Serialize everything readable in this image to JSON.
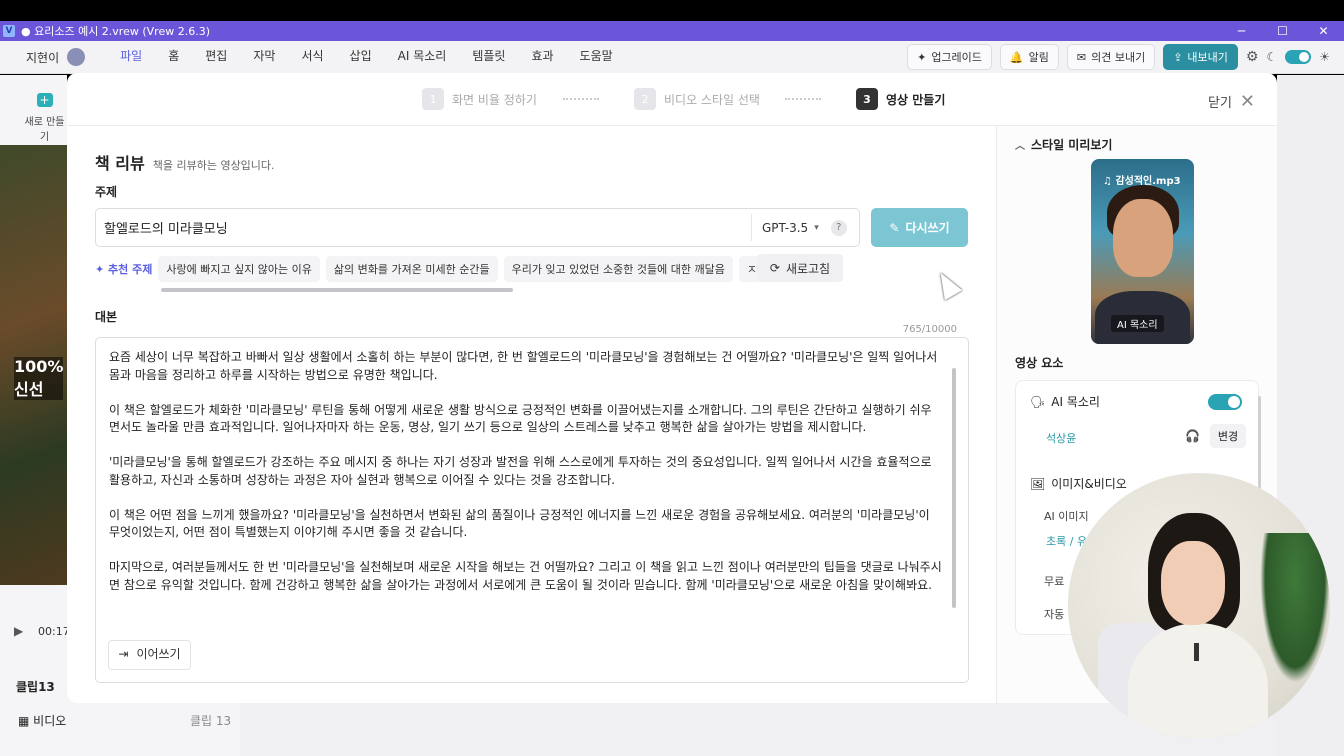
{
  "window": {
    "title": "● 요리소즈 예시 2.vrew (Vrew 2.6.3)",
    "controls": [
      "─",
      "☐",
      "✕"
    ]
  },
  "menubar": {
    "user": "지현이",
    "items": [
      "파일",
      "홈",
      "편집",
      "자막",
      "서식",
      "삽입",
      "AI 목소리",
      "템플릿",
      "효과",
      "도움말"
    ],
    "upgrade": "업그레이드",
    "alarm": "알림",
    "feedback": "의견 보내기",
    "export": "내보내기"
  },
  "background": {
    "new": "새로 만들기",
    "thumb_text": "100%\n신선",
    "time": "00:17",
    "clip": "클립13",
    "video": "비디오",
    "clip_right": "클립 13"
  },
  "modal": {
    "steps": [
      {
        "num": "1",
        "label": "화면 비율 정하기"
      },
      {
        "num": "2",
        "label": "비디오 스타일 선택"
      },
      {
        "num": "3",
        "label": "영상 만들기"
      }
    ],
    "close": "닫기",
    "title": "책 리뷰",
    "title_desc": "책을 리뷰하는 영상입니다.",
    "topic_label": "주제",
    "topic_value": "할엘로드의 미라클모닝",
    "model": "GPT-3.5",
    "help": "?",
    "rewrite": "다시쓰기",
    "rec_label": "추천 주제",
    "rec_chips": [
      "사랑에 빠지고 싶지 않아는 이유",
      "삶의 변화를 가져온 미세한 순간들",
      "우리가 잊고 있었던 소중한 것들에 대한 깨달음",
      "ㅈ"
    ],
    "refresh": "새로고침",
    "script_label": "대본",
    "counter": "765/10000",
    "script_paragraphs": [
      "요즘 세상이 너무 복잡하고 바빠서 일상 생활에서 소홀히 하는 부분이 많다면, 한 번 할엘로드의 '미라클모닝'을 경험해보는 건 어떨까요? '미라클모닝'은 일찍 일어나서 몸과 마음을 정리하고 하루를 시작하는 방법으로 유명한 책입니다.",
      "이 책은 할엘로드가 체화한 '미라클모닝' 루틴을 통해 어떻게 새로운 생활 방식으로 긍정적인 변화를 이끌어냈는지를 소개합니다. 그의 루틴은 간단하고 실행하기 쉬우면서도 놀라울 만큼 효과적입니다. 일어나자마자 하는 운동, 명상, 일기 쓰기 등으로 일상의 스트레스를 낮추고 행복한 삶을 살아가는 방법을 제시합니다.",
      "'미라클모닝'을 통해 할엘로드가 강조하는 주요 메시지 중 하나는 자기 성장과 발전을 위해 스스로에게 투자하는 것의 중요성입니다. 일찍 일어나서 시간을 효율적으로 활용하고, 자신과 소통하며 성장하는 과정은 자아 실현과 행복으로 이어질 수 있다는 것을 강조합니다.",
      "이 책은 어떤 점을 느끼게 했을까요? '미라클모닝'을 실천하면서 변화된 삶의 품질이나 긍정적인 에너지를 느낀 새로운 경험을 공유해보세요. 여러분의 '미라클모닝'이 무엇이었는지, 어떤 점이 특별했는지 이야기해 주시면 좋을 것 같습니다.",
      "마지막으로, 여러분들께서도 한 번 '미라클모닝'을 실천해보며 새로운 시작을 해보는 건 어떨까요? 그리고 이 책을 읽고 느낀 점이나 여러분만의 팁들을 댓글로 나눠주시면 참으로 유익할 것입니다. 함께 건강하고 행복한 삶을 살아가는 과정에서 서로에게 큰 도움이 될 것이라 믿습니다. 함께 '미라클모닝'으로 새로운 아침을 맞이해봐요."
    ],
    "continue": "이어쓰기"
  },
  "panel": {
    "style_preview": "스타일 미리보기",
    "music": "감성적인.mp3",
    "ai_voice_badge": "AI 목소리",
    "elements_title": "영상 요소",
    "ai_voice": "AI 목소리",
    "voice_name": "석상윤",
    "change": "변경",
    "image_video": "이미지&비디오",
    "ai_image": "AI 이미지",
    "green_text": "초록 / 유",
    "free": "무료 ",
    "auto": "자동 "
  },
  "colors": {
    "accent": "#5b5fe0",
    "teal": "#2aa3b5",
    "titlebar": "#6b56d9"
  }
}
